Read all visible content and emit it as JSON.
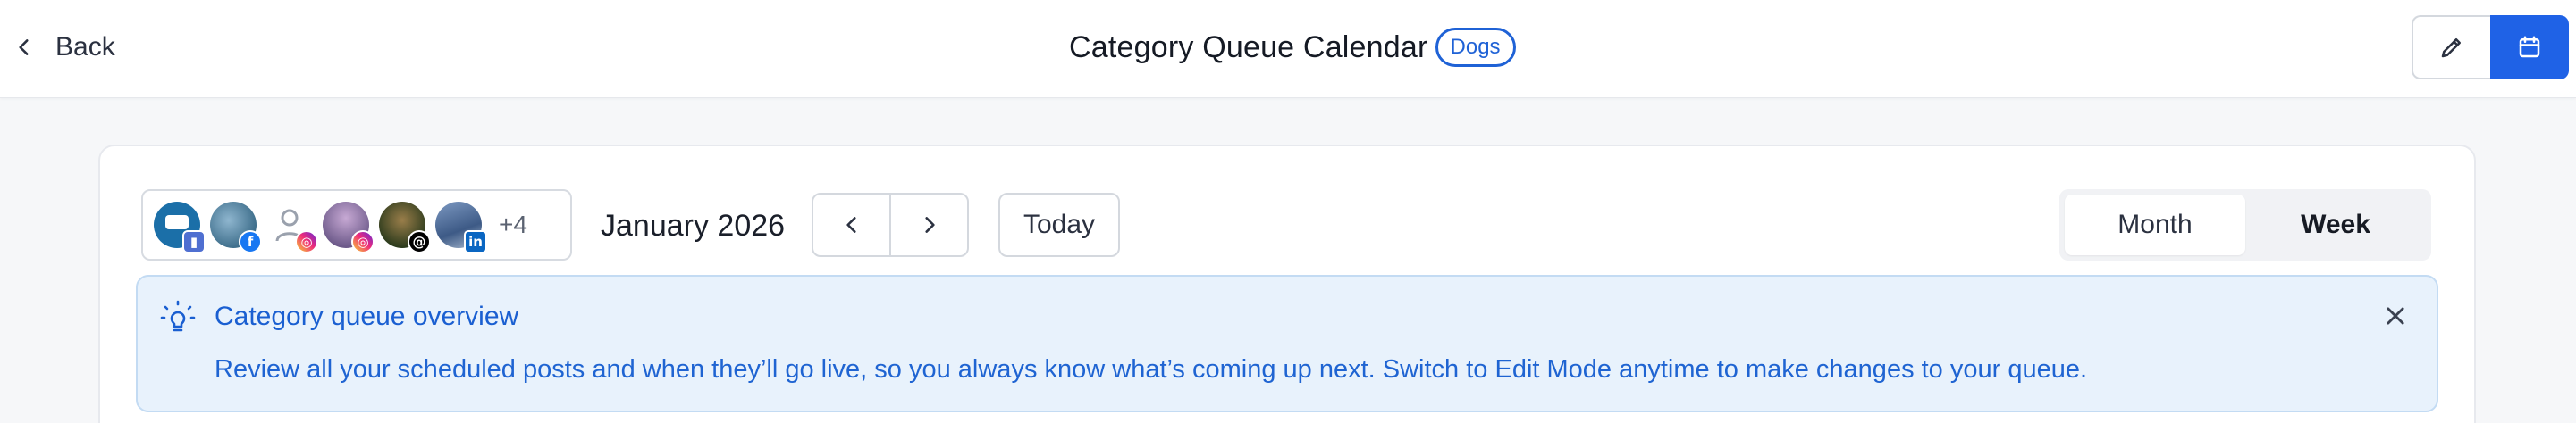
{
  "header": {
    "back_label": "Back",
    "title": "Category Queue Calendar",
    "tag": "Dogs"
  },
  "accounts": {
    "items": [
      {
        "name": "account-google-business",
        "network": "google-business"
      },
      {
        "name": "account-facebook",
        "network": "facebook"
      },
      {
        "name": "account-instagram-placeholder",
        "network": "instagram"
      },
      {
        "name": "account-instagram",
        "network": "instagram"
      },
      {
        "name": "account-threads",
        "network": "threads"
      },
      {
        "name": "account-linkedin",
        "network": "linkedin"
      }
    ],
    "more_count": "+4"
  },
  "calendar": {
    "month_label": "January 2026",
    "today_label": "Today",
    "views": [
      "Month",
      "Week"
    ],
    "active_view": "Month"
  },
  "banner": {
    "title": "Category queue overview",
    "text": "Review all your scheduled posts and when they’ll go live, so you always know what’s coming up next. Switch to Edit Mode anytime to make changes to your queue."
  },
  "colors": {
    "accent": "#1f62e6",
    "banner_bg": "#e8f2fc",
    "banner_text": "#1f64d2"
  }
}
